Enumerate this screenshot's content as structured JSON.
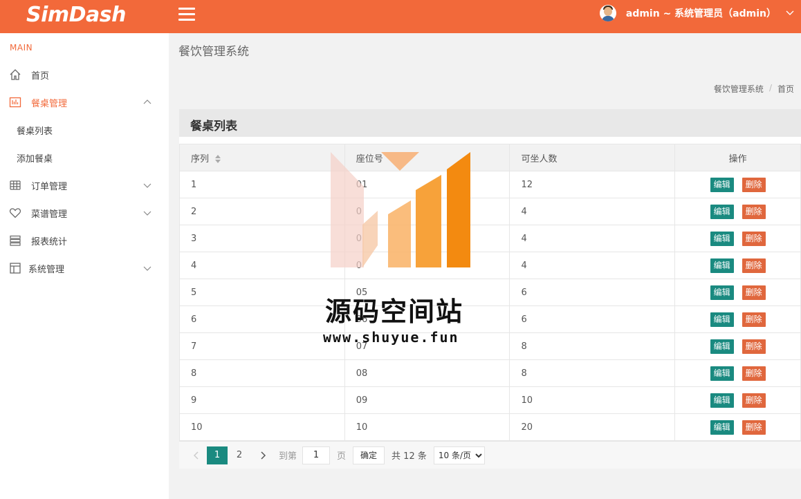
{
  "app": {
    "logo": "SimDash"
  },
  "header": {
    "user": "admin ~ 系统管理员（admin）"
  },
  "sidebar": {
    "section_label": "MAIN",
    "items": [
      {
        "label": "首页",
        "icon": "home-icon"
      },
      {
        "label": "餐桌管理",
        "icon": "table-icon",
        "expanded": true
      },
      {
        "label": "订单管理",
        "icon": "grid-icon"
      },
      {
        "label": "菜谱管理",
        "icon": "heart-icon"
      },
      {
        "label": "报表统计",
        "icon": "report-icon"
      },
      {
        "label": "系统管理",
        "icon": "layout-icon"
      }
    ],
    "sub_items": [
      {
        "label": "餐桌列表"
      },
      {
        "label": "添加餐桌"
      }
    ]
  },
  "page": {
    "title": "餐饮管理系统",
    "breadcrumb": [
      "餐饮管理系统",
      "首页"
    ]
  },
  "panel": {
    "title": "餐桌列表"
  },
  "table": {
    "columns": [
      "序列",
      "座位号",
      "可坐人数",
      "操作"
    ],
    "edit_label": "编辑",
    "delete_label": "删除",
    "rows": [
      {
        "id": "1",
        "seat": "01",
        "capacity": "12"
      },
      {
        "id": "2",
        "seat": "0",
        "capacity": "4"
      },
      {
        "id": "3",
        "seat": "0",
        "capacity": "4"
      },
      {
        "id": "4",
        "seat": "0",
        "capacity": "4"
      },
      {
        "id": "5",
        "seat": "05",
        "capacity": "6"
      },
      {
        "id": "6",
        "seat": "06",
        "capacity": "6"
      },
      {
        "id": "7",
        "seat": "07",
        "capacity": "8"
      },
      {
        "id": "8",
        "seat": "08",
        "capacity": "8"
      },
      {
        "id": "9",
        "seat": "09",
        "capacity": "10"
      },
      {
        "id": "10",
        "seat": "10",
        "capacity": "20"
      }
    ]
  },
  "pager": {
    "pages": [
      "1",
      "2"
    ],
    "current": "1",
    "goto_label": "到第",
    "goto_value": "1",
    "page_label": "页",
    "confirm_label": "确定",
    "total_label": "共 12 条",
    "page_size": "10 条/页"
  },
  "watermark": {
    "text": "源码空间站",
    "url": "www.shuyue.fun"
  },
  "colors": {
    "brand": "#f2693a",
    "edit": "#1a8a80",
    "delete": "#e0673d"
  }
}
